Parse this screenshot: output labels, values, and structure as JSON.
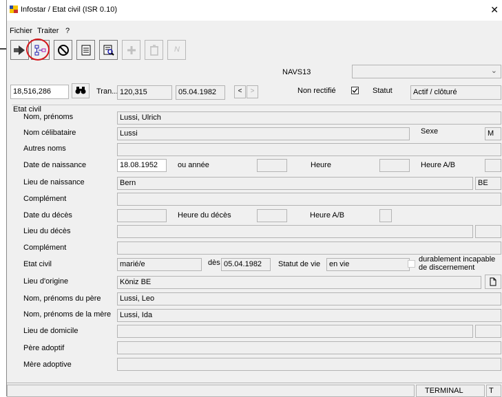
{
  "window": {
    "title": "Infostar / Etat civil (ISR 0.10)"
  },
  "menu": [
    "Fichier",
    "Traiter",
    "?"
  ],
  "header": {
    "navs_label": "NAVS13",
    "navs_value": "",
    "id_value": "18,516,286",
    "tran_label": "Tran...",
    "tran_value": "120,315",
    "tran_date": "05.04.1982",
    "prev_label": "<",
    "next_label": ">",
    "non_rectifie_label": "Non rectifié",
    "statut_label": "Statut",
    "statut_value": "Actif / clôturé"
  },
  "etat_civil": {
    "group_label": "Etat civil",
    "nom_prenoms_label": "Nom, prénoms",
    "nom_prenoms": "Lussi, Ulrich",
    "nom_celibataire_label": "Nom célibataire",
    "nom_celibataire": "Lussi",
    "sexe_label": "Sexe",
    "sexe": "M",
    "autres_noms_label": "Autres noms",
    "date_naissance_label": "Date de naissance",
    "date_naissance": "18.08.1952",
    "ou_annee_label": "ou année",
    "heure_label": "Heure",
    "heure_ab_label": "Heure A/B",
    "lieu_naissance_label": "Lieu de naissance",
    "lieu_naissance": "Bern",
    "lieu_naissance_canton": "BE",
    "complement_label": "Complément",
    "date_deces_label": "Date du décès",
    "heure_deces_label": "Heure du décès",
    "heure_ab_deces_label": "Heure A/B",
    "lieu_deces_label": "Lieu du décès",
    "complement2_label": "Complément",
    "etat_civil_label": "Etat civil",
    "etat_civil_value": "marié/e",
    "des_label": "dès",
    "des_value": "05.04.1982",
    "statut_vie_label": "Statut de vie",
    "statut_vie": "en vie",
    "incapable_label": "durablement incapable de discernement",
    "lieu_origine_label": "Lieu d'origine",
    "lieu_origine": "Köniz BE",
    "pere_label": "Nom, prénoms du père",
    "pere": "Lussi, Leo",
    "mere_label": "Nom, prénoms de la mère",
    "mere": "Lussi, Ida",
    "domicile_label": "Lieu de domicile",
    "pere_adoptif_label": "Père adoptif",
    "mere_adoptive_label": "Mère adoptive"
  },
  "statusbar": {
    "terminal": "TERMINAL",
    "t": "T"
  },
  "toolbar": {
    "n_label": "N"
  }
}
